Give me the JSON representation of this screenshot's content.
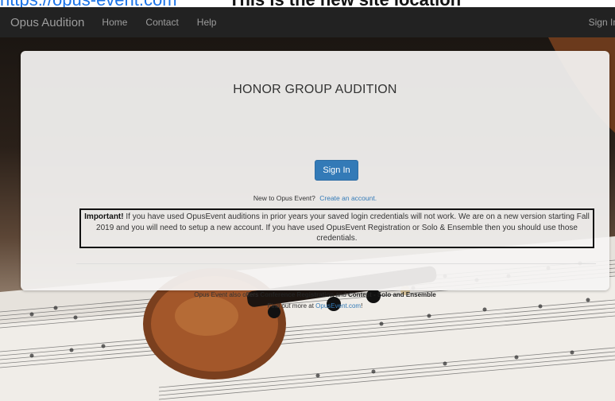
{
  "top_strip": {
    "link_text": "https://opus-event.com",
    "tail_text": "This is the new site location"
  },
  "navbar": {
    "brand": "Opus Audition",
    "links": [
      "Home",
      "Contact",
      "Help"
    ],
    "right_label": "Sign In"
  },
  "card": {
    "title": "HONOR GROUP AUDITION",
    "signin_label": "Sign In",
    "new_prefix": "New to Opus Event?",
    "create_link": "Create an account.",
    "important_label": "Important!",
    "important_text": " If you have used OpusEvent auditions in prior years your saved login credentials will not work. We are on a new version starting Fall 2019 and you will need to setup a new account. If you have used OpusEvent Registration or Solo & Ensemble then you should use those credentials.",
    "offers_prefix": "Opus Event also offers ",
    "offers_bold_1": "Conference Registration",
    "offers_and": " and ",
    "offers_bold_2": "Contest - Solo and Ensemble",
    "find_more_prefix": "Find out more at ",
    "find_more_link": "OpusEvent.com",
    "find_more_suffix": "!"
  },
  "colors": {
    "navbar_bg": "#222222",
    "primary": "#337ab7"
  }
}
